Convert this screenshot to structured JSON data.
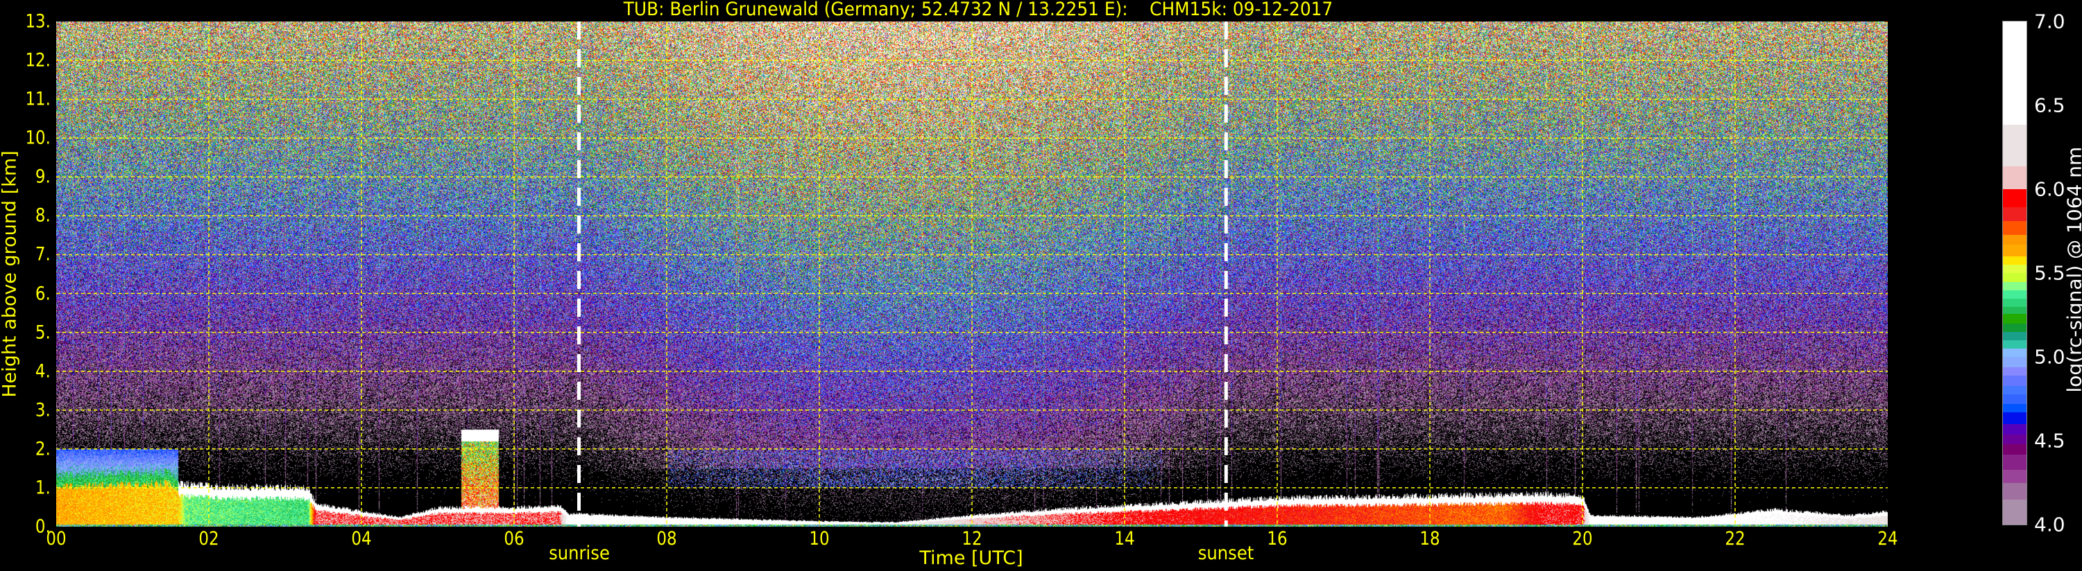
{
  "chart_data": {
    "type": "heatmap",
    "title": "TUB: Berlin Grunewald (Germany; 52.4732 N / 13.2251 E):    CHM15k: 09-12-2017",
    "xlabel": "Time [UTC]",
    "ylabel": "Height above ground [km]",
    "xlim": [
      0,
      24
    ],
    "ylim": [
      0,
      13
    ],
    "xticks": [
      "00",
      "02",
      "04",
      "06",
      "08",
      "10",
      "12",
      "14",
      "16",
      "18",
      "20",
      "22",
      "24"
    ],
    "yticks": [
      "0.",
      "1.",
      "2.",
      "3.",
      "4.",
      "5.",
      "6.",
      "7.",
      "8.",
      "9.",
      "10.",
      "11.",
      "12.",
      "13."
    ],
    "grid": true,
    "annotations": [
      {
        "label": "sunrise",
        "time_h": 6.85
      },
      {
        "label": "sunset",
        "time_h": 15.33
      }
    ],
    "colorbar": {
      "label": "log(rc-signal) @ 1064 nm",
      "range": [
        4.0,
        7.0
      ],
      "ticks": [
        "4.0",
        "4.5",
        "5.0",
        "5.5",
        "6.0",
        "6.5",
        "7.0"
      ],
      "bins": [
        [
          4.0,
          "#aa90aa"
        ],
        [
          4.15,
          "#a070a0"
        ],
        [
          4.25,
          "#994499"
        ],
        [
          4.33,
          "#882288"
        ],
        [
          4.42,
          "#7a0070"
        ],
        [
          4.48,
          "#6a0099"
        ],
        [
          4.54,
          "#5500bb"
        ],
        [
          4.6,
          "#0011ee"
        ],
        [
          4.67,
          "#0055ff"
        ],
        [
          4.72,
          "#3366ff"
        ],
        [
          4.78,
          "#4477ff"
        ],
        [
          4.83,
          "#6677ff"
        ],
        [
          4.89,
          "#8888ff"
        ],
        [
          4.94,
          "#88aaff"
        ],
        [
          5.0,
          "#88bbff"
        ],
        [
          5.05,
          "#30c4a8"
        ],
        [
          5.1,
          "#1a9f8a"
        ],
        [
          5.15,
          "#119933"
        ],
        [
          5.2,
          "#22aa00"
        ],
        [
          5.26,
          "#22bb55"
        ],
        [
          5.3,
          "#2dd47a"
        ],
        [
          5.35,
          "#44ee99"
        ],
        [
          5.4,
          "#88ff88"
        ],
        [
          5.45,
          "#ccff33"
        ],
        [
          5.5,
          "#e0ff40"
        ],
        [
          5.55,
          "#ffe600"
        ],
        [
          5.6,
          "#ffaa00"
        ],
        [
          5.67,
          "#ff9900"
        ],
        [
          5.73,
          "#ff5500"
        ],
        [
          5.81,
          "#f02020"
        ],
        [
          5.894,
          "#ff0000"
        ],
        [
          6.0,
          "#f0c4c4"
        ],
        [
          6.14,
          "#ebe3e3"
        ],
        [
          6.385,
          "#ffffff"
        ]
      ]
    },
    "boundary_layer_top_km": [
      [
        0,
        1.3
      ],
      [
        1.5,
        1.4
      ],
      [
        1.6,
        1.1
      ],
      [
        2,
        1.05
      ],
      [
        3.3,
        1.0
      ],
      [
        3.4,
        0.6
      ],
      [
        4,
        0.4
      ],
      [
        4.5,
        0.25
      ],
      [
        5,
        0.5
      ],
      [
        6,
        0.5
      ],
      [
        6.6,
        0.55
      ],
      [
        6.7,
        0.35
      ],
      [
        8,
        0.25
      ],
      [
        9,
        0.2
      ],
      [
        10,
        0.15
      ],
      [
        11,
        0.12
      ],
      [
        12,
        0.3
      ],
      [
        13,
        0.45
      ],
      [
        14,
        0.55
      ],
      [
        15,
        0.65
      ],
      [
        16,
        0.75
      ],
      [
        18,
        0.8
      ],
      [
        19.5,
        0.85
      ],
      [
        20,
        0.8
      ],
      [
        20.1,
        0.3
      ],
      [
        21.5,
        0.25
      ],
      [
        22.5,
        0.45
      ],
      [
        23.5,
        0.3
      ],
      [
        24,
        0.4
      ]
    ],
    "boundary_layer_signal": [
      [
        0,
        5.65
      ],
      [
        1.6,
        5.6
      ],
      [
        1.7,
        5.4
      ],
      [
        3.3,
        5.35
      ],
      [
        3.4,
        6.0
      ],
      [
        6.6,
        6.0
      ],
      [
        6.7,
        6.5
      ],
      [
        8,
        6.5
      ],
      [
        11,
        6.5
      ],
      [
        12,
        6.1
      ],
      [
        14,
        5.95
      ],
      [
        17.5,
        5.8
      ],
      [
        19,
        5.75
      ],
      [
        19.5,
        5.95
      ],
      [
        20,
        5.95
      ],
      [
        20.1,
        6.5
      ],
      [
        22,
        6.5
      ],
      [
        24,
        6.3
      ]
    ],
    "colors": {
      "axis_text": "#ffff00",
      "grid": "#ffff00",
      "marker_lines": "#ffffff",
      "background": "#000000"
    }
  }
}
